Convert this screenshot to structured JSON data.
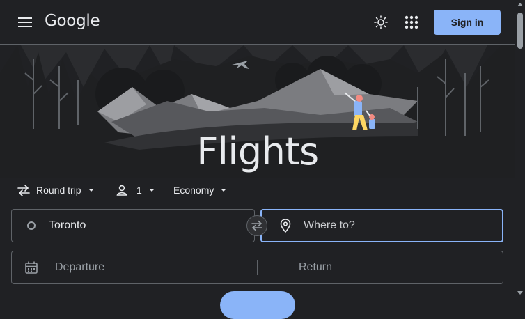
{
  "header": {
    "logo": "Google",
    "signin_label": "Sign in",
    "icons": [
      "menu-icon",
      "theme-toggle-icon",
      "apps-grid-icon"
    ]
  },
  "hero": {
    "title": "Flights"
  },
  "options": {
    "trip_type": "Round trip",
    "passengers": "1",
    "cabin_class": "Economy"
  },
  "search": {
    "from_value": "Toronto",
    "to_placeholder": "Where to?",
    "departure_placeholder": "Departure",
    "return_placeholder": "Return"
  },
  "colors": {
    "background": "#202124",
    "accent": "#8ab4f8",
    "text": "#e8eaed",
    "muted": "#9aa0a6",
    "border": "#5f6368"
  }
}
